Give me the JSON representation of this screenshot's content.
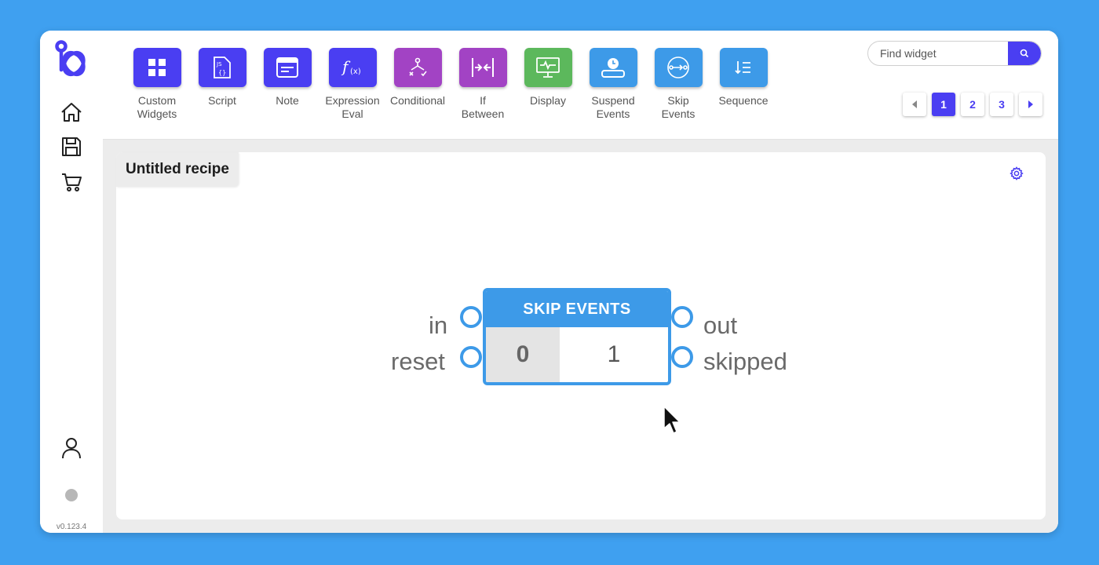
{
  "app": {
    "version": "v0.123.4",
    "colors": {
      "accent": "#4a3ef2",
      "node": "#3d9ae8",
      "background": "#3fa0f0"
    }
  },
  "sidebar": {
    "icons": [
      "logo-icon",
      "home-icon",
      "save-icon",
      "cart-icon",
      "user-icon"
    ]
  },
  "toolbar": {
    "widgets": [
      {
        "label": "Custom\nWidgets",
        "icon": "grid-icon",
        "color": "#4a3ef2"
      },
      {
        "label": "Script",
        "icon": "js-file-icon",
        "color": "#4a3ef2"
      },
      {
        "label": "Note",
        "icon": "note-icon",
        "color": "#4a3ef2"
      },
      {
        "label": "Expression\nEval",
        "icon": "function-icon",
        "color": "#4a3ef2"
      },
      {
        "label": "Conditional",
        "icon": "conditional-icon",
        "color": "#a243c4"
      },
      {
        "label": "If\nBetween",
        "icon": "if-between-icon",
        "color": "#a243c4"
      },
      {
        "label": "Display",
        "icon": "monitor-icon",
        "color": "#5cb85c"
      },
      {
        "label": "Suspend\nEvents",
        "icon": "clock-icon",
        "color": "#3d9ae8"
      },
      {
        "label": "Skip\nEvents",
        "icon": "skip-icon",
        "color": "#3d9ae8"
      },
      {
        "label": "Sequence",
        "icon": "sequence-icon",
        "color": "#3d9ae8"
      }
    ]
  },
  "search": {
    "placeholder": "Find widget"
  },
  "pagination": {
    "pages": [
      "1",
      "2",
      "3"
    ],
    "current": "1"
  },
  "canvas": {
    "recipe_title": "Untitled recipe",
    "node": {
      "title": "SKIP EVENTS",
      "value_a": "0",
      "value_b": "1",
      "inputs": [
        "in",
        "reset"
      ],
      "outputs": [
        "out",
        "skipped"
      ]
    }
  }
}
